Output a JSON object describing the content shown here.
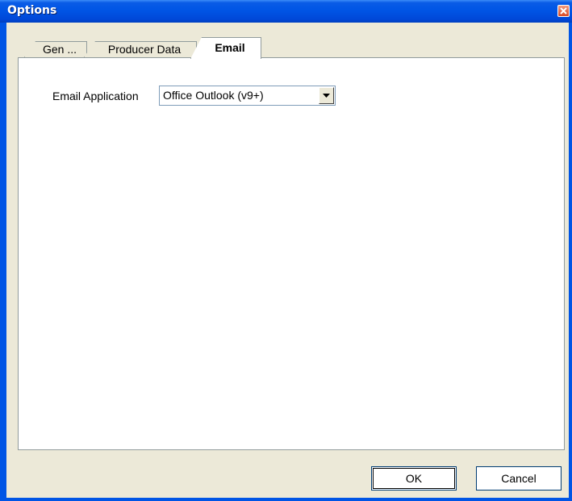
{
  "window": {
    "title": "Options",
    "close_icon": "close-icon"
  },
  "tabs": [
    {
      "label": "Gen ...",
      "selected": false
    },
    {
      "label": "Producer Data",
      "selected": false
    },
    {
      "label": "Email",
      "selected": true
    }
  ],
  "email_tab": {
    "application_label": "Email Application",
    "application_value": "Office Outlook (v9+)",
    "dropdown_icon": "chevron-down-icon"
  },
  "buttons": {
    "ok_label": "OK",
    "cancel_label": "Cancel"
  },
  "colors": {
    "titlebar": "#0055e5",
    "window_bg": "#ece9d8",
    "close_button": "#d84a25"
  }
}
